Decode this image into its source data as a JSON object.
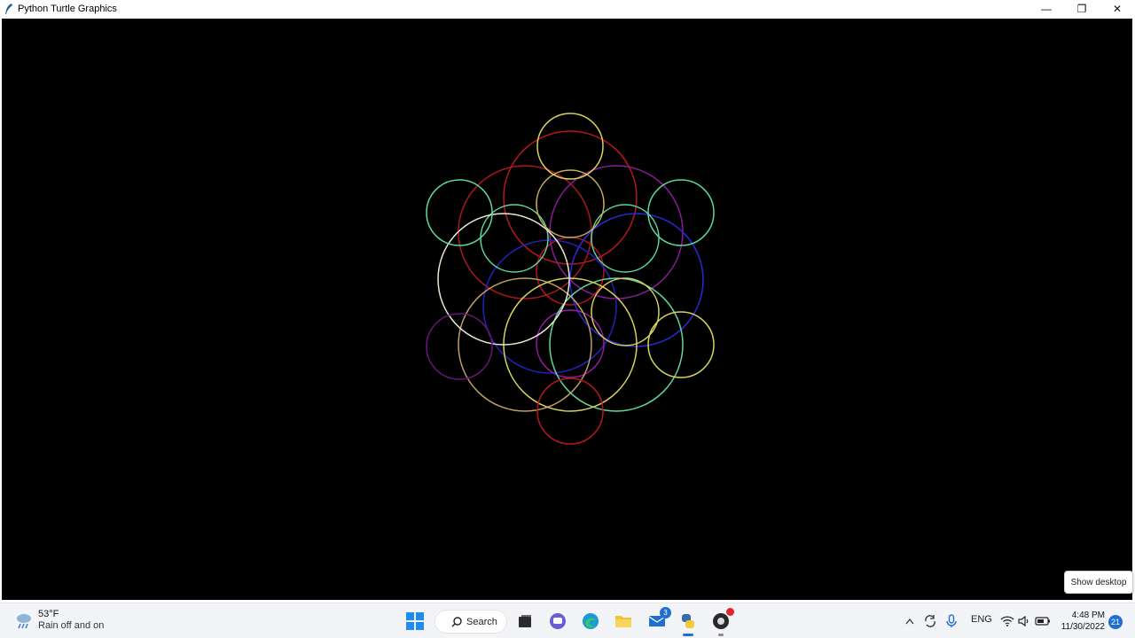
{
  "window": {
    "title": "Python Turtle Graphics",
    "minimize_glyph": "—",
    "restore_glyph": "❐",
    "close_glyph": "✕"
  },
  "canvas": {
    "background": "#000000",
    "pattern": "overlapping circles (sacred geometry, turtle drawing)",
    "circle_colors": [
      "#d6d35a",
      "#5fd89a",
      "#b8161d",
      "#8a1a9a",
      "#2a2ad6",
      "#e8e8c8",
      "#c0b060"
    ]
  },
  "taskbar": {
    "weather": {
      "temp": "53°F",
      "condition": "Rain off and on",
      "icon": "rain-cloud-icon"
    },
    "search_label": "Search",
    "pinned": [
      {
        "name": "start-button",
        "icon": "windows-logo-icon"
      },
      {
        "name": "file-manager-button",
        "icon": "folder-icon"
      },
      {
        "name": "teams-chat-button",
        "icon": "chat-icon"
      },
      {
        "name": "edge-button",
        "icon": "edge-icon"
      },
      {
        "name": "explorer-button",
        "icon": "folder-icon"
      },
      {
        "name": "mail-button",
        "icon": "mail-icon",
        "badge": "3"
      },
      {
        "name": "python-button",
        "icon": "python-icon"
      },
      {
        "name": "obs-button",
        "icon": "record-icon"
      }
    ],
    "tray": {
      "language": "ENG",
      "time": "4:48 PM",
      "date": "11/30/2022",
      "notifications": "21"
    },
    "tooltip": "Show desktop"
  }
}
